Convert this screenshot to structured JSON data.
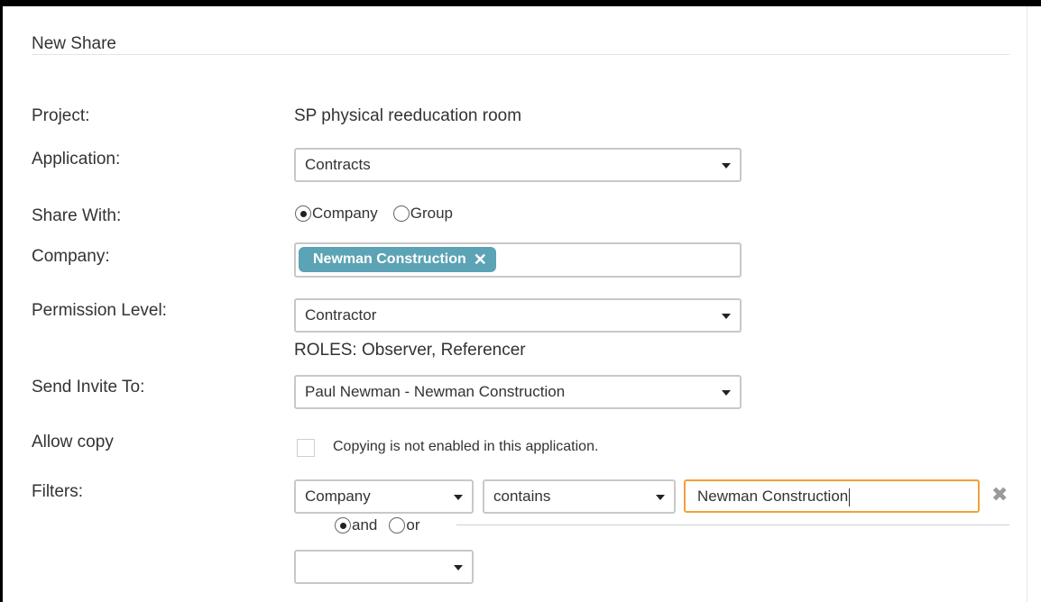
{
  "dialog": {
    "title": "New Share"
  },
  "form": {
    "project": {
      "label": "Project:",
      "value": "SP physical reeducation room"
    },
    "application": {
      "label": "Application:",
      "selected": "Contracts"
    },
    "share_with": {
      "label": "Share With:",
      "options": [
        "Company",
        "Group"
      ],
      "selected": "Company"
    },
    "company": {
      "label": "Company:",
      "tags": [
        "Newman Construction"
      ],
      "tag_remove_symbol": "✕"
    },
    "permission_level": {
      "label": "Permission Level:",
      "selected": "Contractor",
      "roles_text": "ROLES: Observer, Referencer"
    },
    "send_invite_to": {
      "label": "Send Invite To:",
      "selected": "Paul Newman - Newman Construction"
    },
    "allow_copy": {
      "label": "Allow copy",
      "checked": false,
      "note": "Copying is not enabled in this application."
    },
    "filters": {
      "label": "Filters:",
      "field": "Company",
      "operator": "contains",
      "value": "Newman Construction",
      "remove_symbol": "✖",
      "logic_options": [
        "and",
        "or"
      ],
      "logic_selected": "and",
      "next_field": ""
    }
  },
  "colors": {
    "tag_bg": "#5ba3b5",
    "focus_border": "#f0a03a"
  },
  "icons": {
    "dropdown": "caret-down-icon",
    "tag_remove": "close-icon",
    "filter_remove": "remove-filter-icon"
  }
}
